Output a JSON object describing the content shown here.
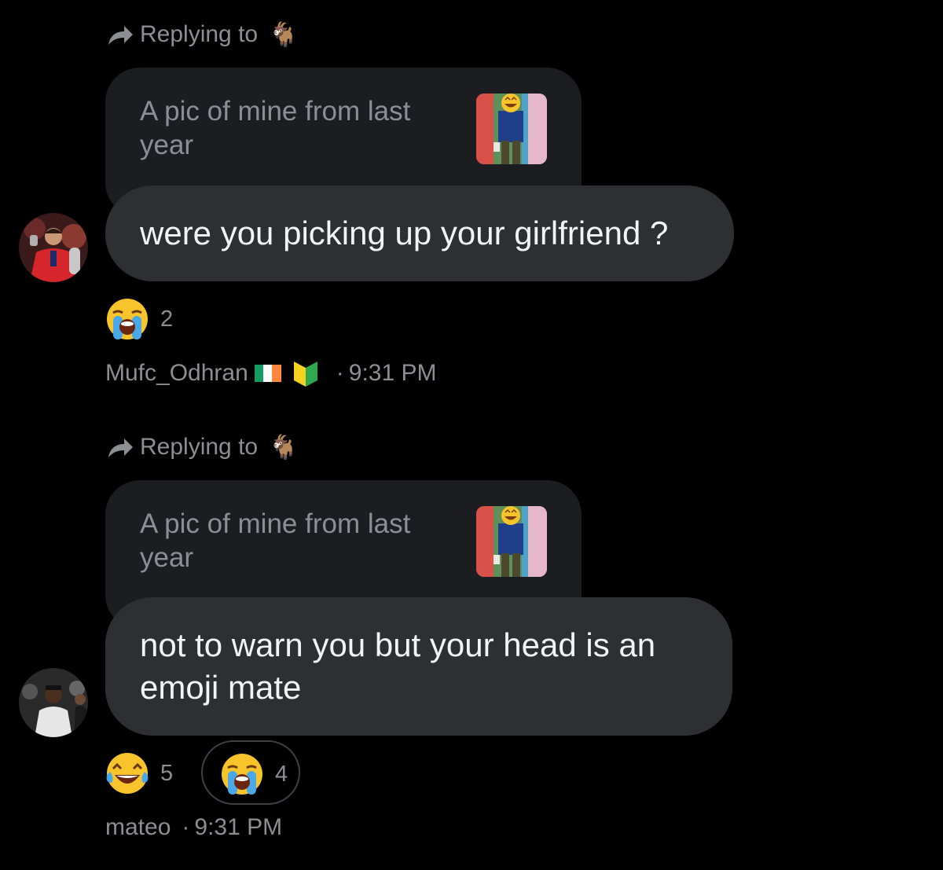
{
  "messages": [
    {
      "reply_label": "Replying to",
      "reply_target_icon": "goat-emoji",
      "quoted_text": "A pic of mine from last year",
      "text": "were you picking up your girlfriend ?",
      "reactions": [
        {
          "emoji": "loudly-crying-face",
          "count": "2"
        }
      ],
      "sender": "Mufc_Odhran",
      "sender_flags": [
        "ireland-flag",
        "japanese-beginner-symbol"
      ],
      "separator": "·",
      "time": "9:31 PM"
    },
    {
      "reply_label": "Replying to",
      "reply_target_icon": "goat-emoji",
      "quoted_text": "A pic of mine from last year",
      "text": "not to warn you but your head is an emoji mate",
      "reactions": [
        {
          "emoji": "tears-of-joy-face",
          "count": "5"
        },
        {
          "emoji": "loudly-crying-face",
          "count": "4",
          "selected": true
        }
      ],
      "sender": "mateo",
      "separator": "·",
      "time": "9:31 PM"
    }
  ],
  "colors": {
    "background": "#000000",
    "bubble": "#2e2f33",
    "quote_bubble": "#1c1d20",
    "secondary_text": "#8b8f94",
    "primary_text": "#f2f3f5"
  }
}
